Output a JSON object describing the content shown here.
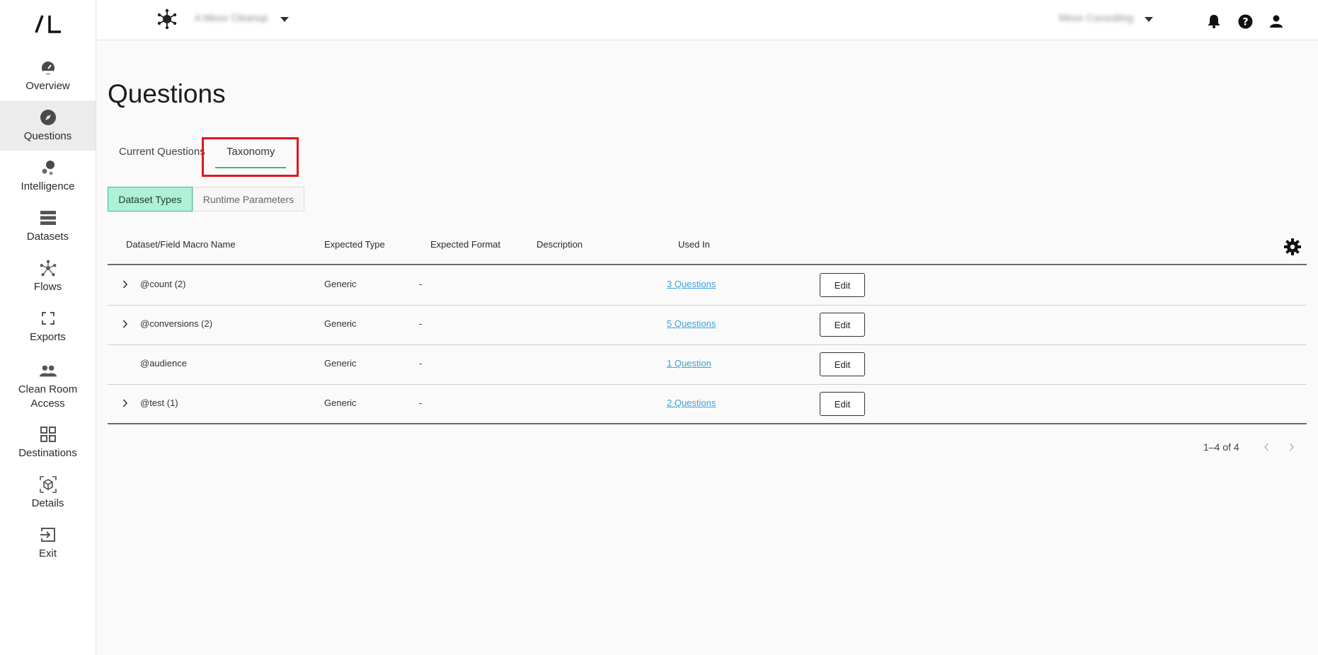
{
  "brand": {
    "logo_text": "/L"
  },
  "sidebar": {
    "items": [
      {
        "label": "Overview",
        "icon": "gauge-icon"
      },
      {
        "label": "Questions",
        "icon": "compass-icon",
        "active": true
      },
      {
        "label": "Intelligence",
        "icon": "bubbles-icon"
      },
      {
        "label": "Datasets",
        "icon": "stack-icon"
      },
      {
        "label": "Flows",
        "icon": "network-icon"
      },
      {
        "label": "Exports",
        "icon": "frame-corners-icon"
      },
      {
        "label": "Clean Room Access",
        "icon": "people-icon"
      },
      {
        "label": "Destinations",
        "icon": "grid-icon"
      },
      {
        "label": "Details",
        "icon": "cube-icon"
      },
      {
        "label": "Exit",
        "icon": "exit-icon"
      }
    ]
  },
  "header": {
    "cleanroom_name": "A Minor Cleanup",
    "account_name": "Minor Consulting"
  },
  "page": {
    "title": "Questions",
    "tabs": [
      {
        "label": "Current Questions",
        "active": false
      },
      {
        "label": "Taxonomy",
        "active": true
      }
    ],
    "segments": [
      {
        "label": "Dataset Types",
        "active": true
      },
      {
        "label": "Runtime Parameters",
        "active": false
      }
    ]
  },
  "table": {
    "columns": [
      "Dataset/Field Macro Name",
      "Expected Type",
      "Expected Format",
      "Description",
      "Used In"
    ],
    "rows": [
      {
        "name": "@count (2)",
        "type": "Generic",
        "format": "-",
        "description": "",
        "used_in": "3 Questions",
        "expandable": true,
        "action": "Edit"
      },
      {
        "name": "@conversions (2)",
        "type": "Generic",
        "format": "-",
        "description": "",
        "used_in": "5 Questions",
        "expandable": true,
        "action": "Edit"
      },
      {
        "name": "@audience",
        "type": "Generic",
        "format": "-",
        "description": "",
        "used_in": "1 Question",
        "expandable": false,
        "action": "Edit"
      },
      {
        "name": "@test (1)",
        "type": "Generic",
        "format": "-",
        "description": "",
        "used_in": "2 Questions",
        "expandable": true,
        "action": "Edit"
      }
    ],
    "pagination": "1–4 of 4"
  },
  "colors": {
    "accent_green": "#3dba6f",
    "segment_active_bg": "#aef1d6",
    "link": "#3da3d7",
    "highlight": "#e0161e"
  }
}
